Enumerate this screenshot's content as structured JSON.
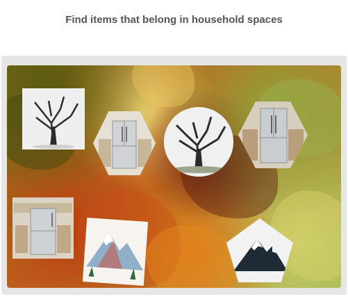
{
  "header": {
    "title": "Find items that belong in household spaces"
  },
  "board": {
    "items": [
      {
        "kind": "tree",
        "shape": "square",
        "icon": "tree-icon"
      },
      {
        "kind": "refrigerator",
        "shape": "hexagon",
        "icon": "refrigerator-icon"
      },
      {
        "kind": "tree",
        "shape": "circle",
        "icon": "tree-icon"
      },
      {
        "kind": "refrigerator",
        "shape": "hexagon",
        "icon": "refrigerator-icon"
      },
      {
        "kind": "refrigerator",
        "shape": "square",
        "icon": "refrigerator-icon"
      },
      {
        "kind": "mountain",
        "shape": "square",
        "icon": "mountain-icon"
      },
      {
        "kind": "mountain",
        "shape": "pentagon",
        "icon": "mountain-icon"
      }
    ]
  },
  "colors": {
    "title_text": "#555555",
    "frame": "#e6e6e6"
  }
}
